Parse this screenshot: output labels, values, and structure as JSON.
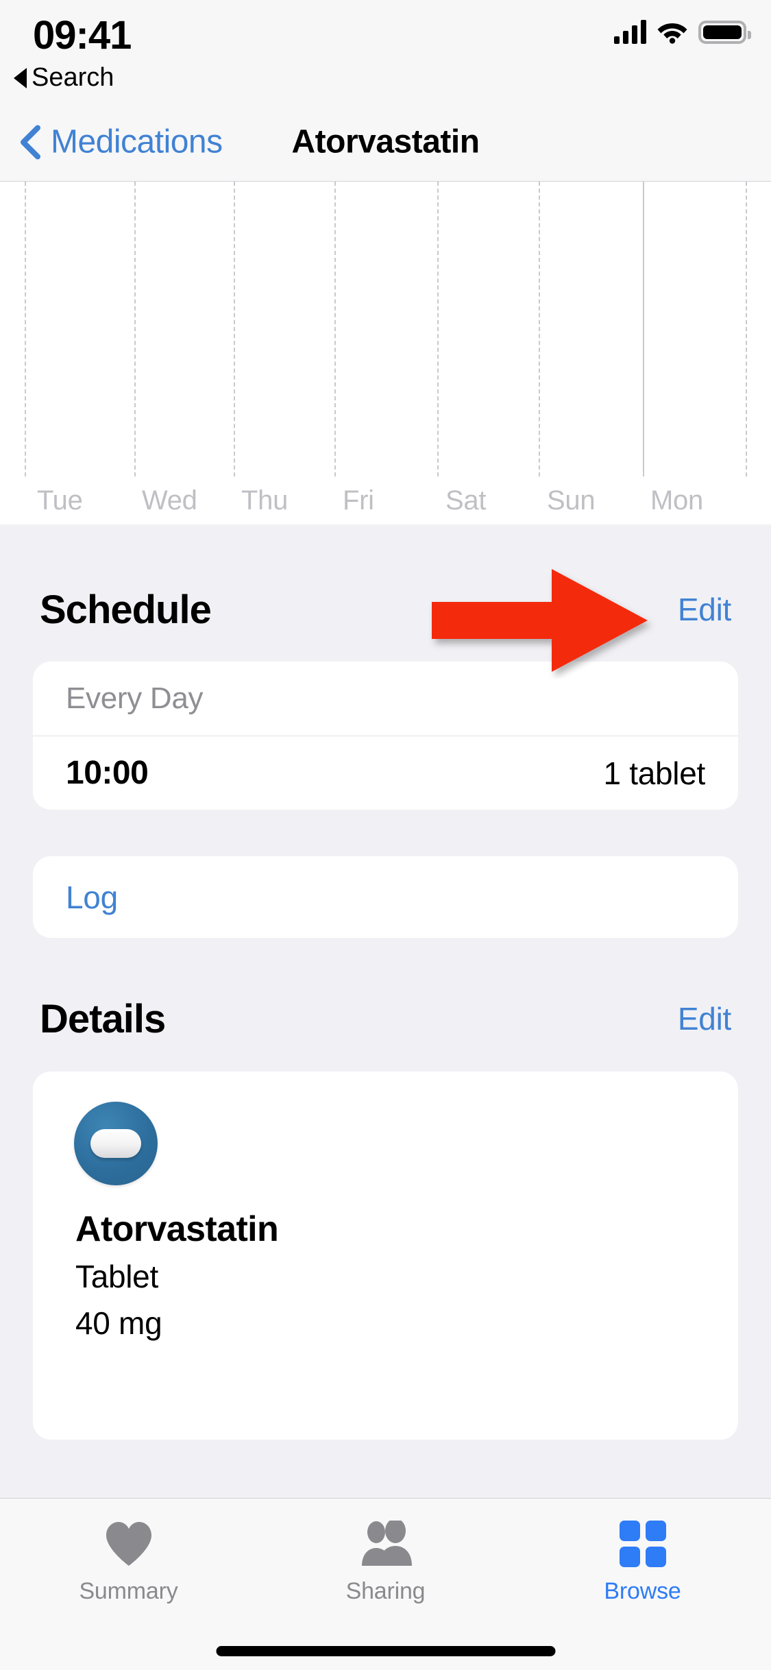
{
  "status_bar": {
    "time": "09:41",
    "back_app_label": "Search",
    "icons": [
      "cellular-signal-icon",
      "wifi-icon",
      "battery-icon"
    ]
  },
  "nav_bar": {
    "back_label": "Medications",
    "title": "Atorvastatin",
    "back_icon": "chevron-left-icon",
    "accent_color": "#4182D3"
  },
  "chart_data": {
    "type": "bar",
    "title": "",
    "categories": [
      "Tue",
      "Wed",
      "Thu",
      "Fri",
      "Sat",
      "Sun",
      "Mon"
    ],
    "values": [
      0,
      0,
      0,
      0,
      0,
      0,
      0
    ],
    "xlabel": "",
    "ylabel": "",
    "grid": "vertical-dashed",
    "note": "empty medication dose chart, no bars plotted"
  },
  "schedule": {
    "heading": "Schedule",
    "edit_label": "Edit",
    "frequency": "Every Day",
    "time": "10:00",
    "dose": "1 tablet",
    "log_label": "Log"
  },
  "details": {
    "heading": "Details",
    "edit_label": "Edit",
    "icon_name": "medication-pill-icon",
    "icon_color": "#2D6E9D",
    "name": "Atorvastatin",
    "form": "Tablet",
    "strength": "40 mg"
  },
  "annotation": {
    "type": "arrow",
    "color": "#F42A10",
    "direction": "right",
    "points_to": "Edit"
  },
  "tab_bar": {
    "tabs": [
      {
        "label": "Summary",
        "icon": "heart-icon",
        "active": false
      },
      {
        "label": "Sharing",
        "icon": "people-icon",
        "active": false
      },
      {
        "label": "Browse",
        "icon": "grid-icon",
        "active": true
      }
    ],
    "active_color": "#2E7CF6",
    "inactive_color": "#8A8A8E"
  }
}
